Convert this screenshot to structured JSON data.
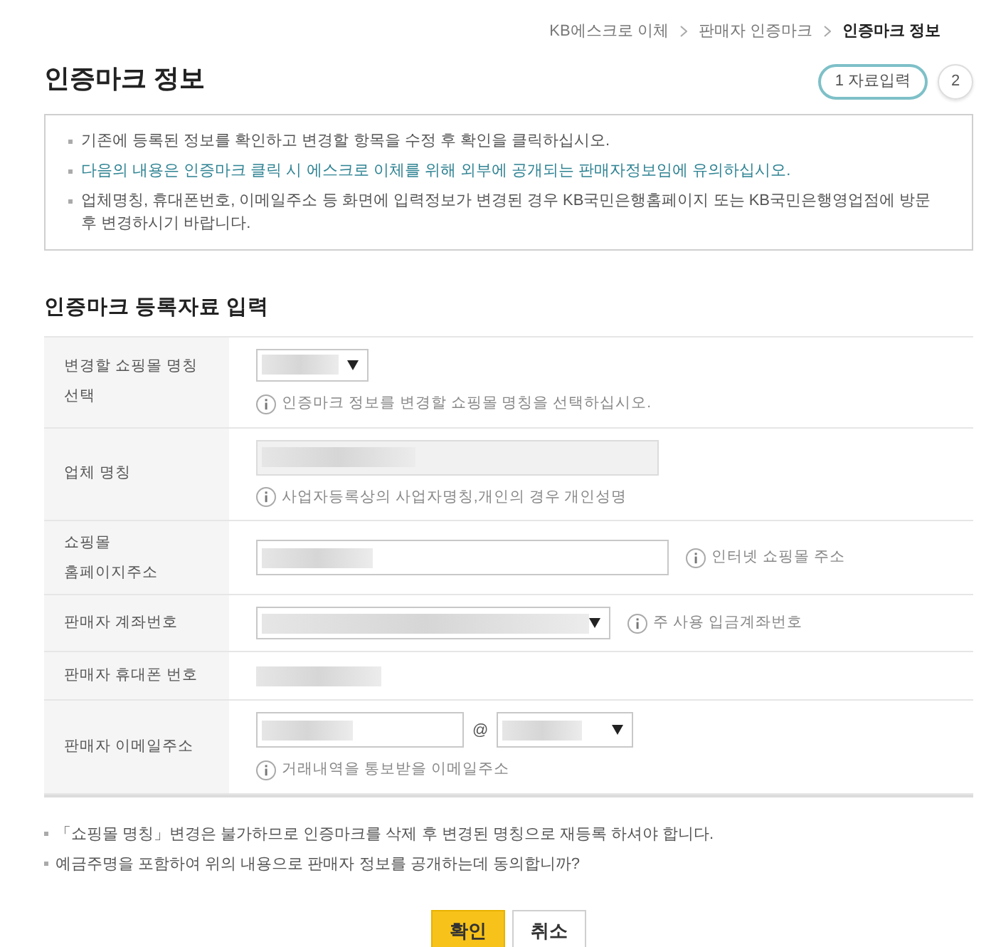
{
  "breadcrumb": [
    {
      "label": "KB에스크로 이체",
      "current": false
    },
    {
      "label": "판매자 인증마크",
      "current": false
    },
    {
      "label": "인증마크 정보",
      "current": true
    }
  ],
  "page_title": "인증마크 정보",
  "steps": [
    {
      "number": "1",
      "label": "자료입력",
      "selected": true
    },
    {
      "number": "2",
      "selected": false
    }
  ],
  "notice": [
    {
      "text": "기존에 등록된 정보를 확인하고 변경할 항목을 수정 후 확인을 클릭하십시오.",
      "highlighted": false
    },
    {
      "text": "다음의 내용은 인증마크 클릭 시 에스크로 이체를 위해 외부에 공개되는 판매자정보임에 유의하십시오.",
      "highlighted": true
    },
    {
      "text": "업체명칭, 휴대폰번호, 이메일주소 등 화면에 입력정보가 변경된 경우 KB국민은행홈페이지 또는 KB국민은행영업점에 방문 후 변경하시기 바랍니다.",
      "highlighted": false
    }
  ],
  "section_title": "인증마크 등록자료 입력",
  "form_rows": [
    {
      "label": "변경할 쇼핑몰 명칭\n선택",
      "kind": "select",
      "hint": {
        "text": "인증마크 정보를 변경할 쇼핑몰 명칭을 선택하십시오.",
        "inline": false
      }
    },
    {
      "label": "업체 명칭",
      "kind": "input",
      "disabled": true,
      "hint": {
        "text": "사업자등록상의 사업자명칭,개인의 경우 개인성명",
        "inline": false
      }
    },
    {
      "label": "쇼핑몰\n홈페이지주소",
      "kind": "input",
      "disabled": false,
      "hint": {
        "text": "인터넷 쇼핑몰 주소",
        "inline": true
      }
    },
    {
      "label": "판매자 계좌번호",
      "kind": "select",
      "hint": {
        "text": "주 사용 입금계좌번호",
        "inline": true
      }
    },
    {
      "label": "판매자 휴대폰 번호",
      "kind": "text"
    },
    {
      "label": "판매자 이메일주소",
      "kind": "email",
      "separator": "@",
      "hint": {
        "text": "거래내역을 통보받을 이메일주소",
        "inline": false
      }
    }
  ],
  "notes": [
    "「쇼핑몰 명칭」변경은 불가하므로 인증마크를 삭제 후 변경된 명칭으로 재등록 하셔야 합니다.",
    "예금주명을 포함하여 위의 내용으로 판매자 정보를 공개하는데 동의합니까?"
  ],
  "buttons": [
    {
      "label": "확인",
      "kind": "primary"
    },
    {
      "label": "취소",
      "kind": "secondary"
    }
  ]
}
